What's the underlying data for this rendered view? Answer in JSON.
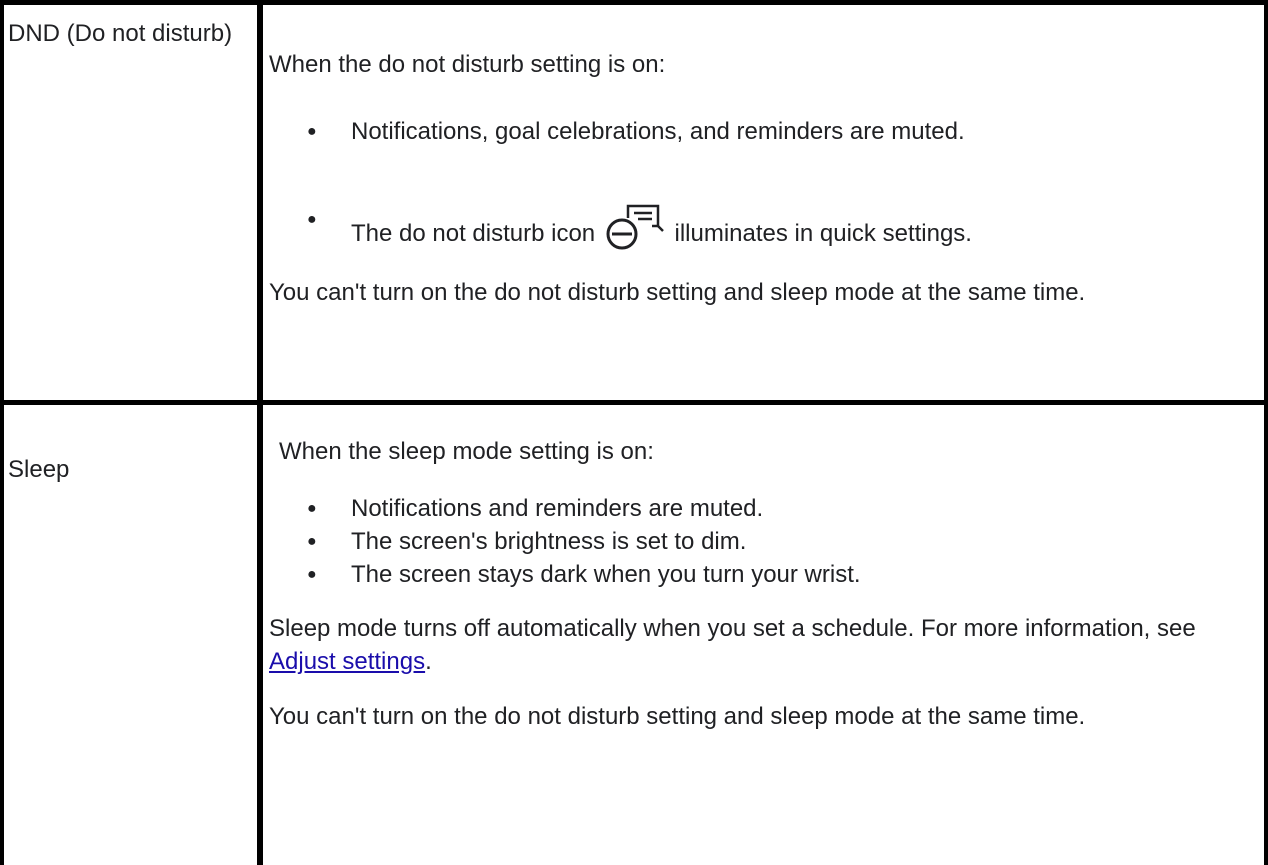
{
  "rows": [
    {
      "label": "DND (Do not disturb)",
      "intro": "When the do not disturb setting is on:",
      "bullets": [
        "Notifications, goal celebrations, and reminders are muted.",
        "illuminates in quick settings."
      ],
      "icon_bullet_prefix": "The do not disturb icon",
      "icon": "do-not-disturb-icon",
      "note": "You can't turn on the do not disturb setting and sleep mode at the same time."
    },
    {
      "label": "Sleep",
      "intro": "When the sleep mode setting is on:",
      "bullets": [
        "Notifications and reminders are muted.",
        "The screen's brightness is set to dim.",
        "The screen stays dark when you turn your wrist."
      ],
      "para1_before": "Sleep mode turns off automatically when you set a schedule. For more information, see ",
      "para1_link": "Adjust settings",
      "para1_after": ".",
      "note": "You can't turn on the do not disturb setting and sleep mode at the same time."
    }
  ],
  "bullet_glyph": "●",
  "colors": {
    "link": "#1a0dab",
    "border": "#000000",
    "text": "#202124"
  }
}
